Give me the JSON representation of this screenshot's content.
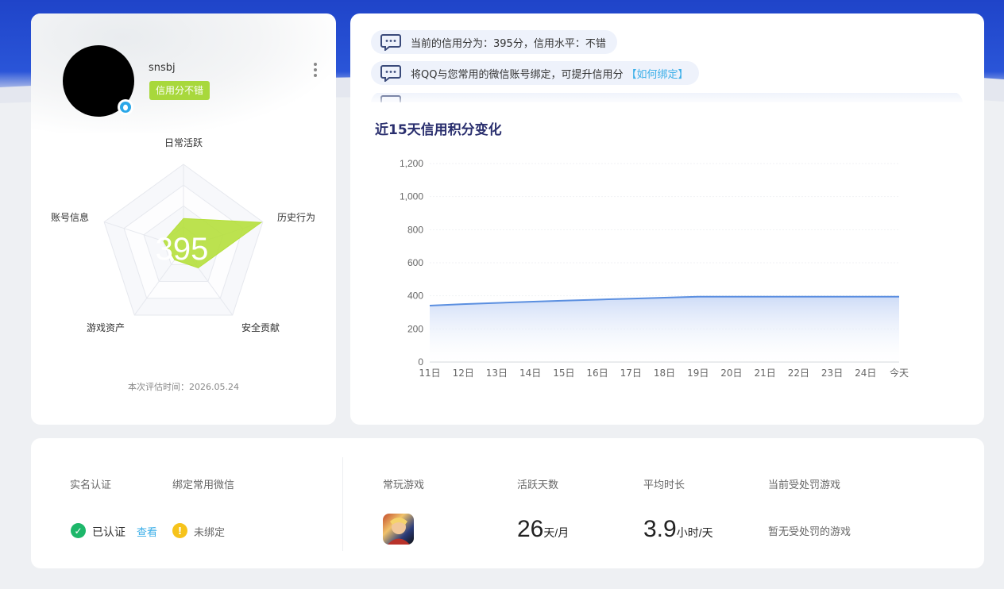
{
  "profile": {
    "username": "snsbj",
    "credit_tag": "信用分不错",
    "score": "395",
    "eval_time": "本次评估时间：2026.05.24",
    "radar": {
      "labels": [
        "日常活跃",
        "历史行为",
        "安全贡献",
        "游戏资产",
        "账号信息"
      ],
      "values": [
        0.35,
        0.98,
        0.3,
        0.18,
        0.25
      ],
      "fill_color": "#b5df3c"
    }
  },
  "notices": [
    {
      "text": "当前的信用分为：395分，信用水平：不错"
    },
    {
      "text": "将QQ与您常用的微信账号绑定，可提升信用分",
      "link": "【如何绑定】"
    }
  ],
  "chart_title": "近15天信用积分变化",
  "chart_data": {
    "type": "area",
    "categories": [
      "11日",
      "12日",
      "13日",
      "14日",
      "15日",
      "16日",
      "17日",
      "18日",
      "19日",
      "20日",
      "21日",
      "22日",
      "23日",
      "24日",
      "今天"
    ],
    "values": [
      341,
      350,
      357,
      364,
      371,
      377,
      383,
      389,
      395,
      395,
      395,
      395,
      395,
      395,
      395
    ],
    "yticks": [
      "0",
      "200",
      "400",
      "600",
      "800",
      "1,000",
      "1,200"
    ],
    "ylim": [
      0,
      1200
    ],
    "line_color": "#5b8fe0"
  },
  "stats": {
    "real_name_label": "实名认证",
    "real_name_status": "已认证",
    "real_name_link": "查看",
    "wechat_label": "绑定常用微信",
    "wechat_status": "未绑定",
    "game_label": "常玩游戏",
    "active_label": "活跃天数",
    "active_value": "26",
    "active_unit": "天/月",
    "avg_label": "平均时长",
    "avg_value": "3.9",
    "avg_unit": "小时/天",
    "punish_label": "当前受处罚游戏",
    "punish_value": "暂无受处罚的游戏"
  }
}
